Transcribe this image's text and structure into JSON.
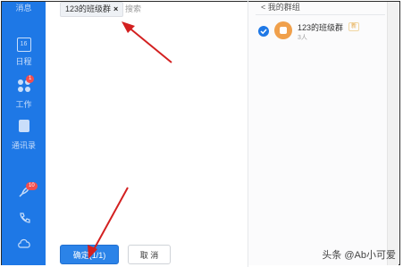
{
  "sidebar": {
    "items": [
      {
        "label": "消息",
        "icon": "chat-icon"
      },
      {
        "label": "日程",
        "icon": "calendar-icon",
        "icon_text": "16"
      },
      {
        "label": "工作",
        "icon": "apps-icon",
        "badge": "1"
      },
      {
        "label": "通讯录",
        "icon": "contacts-icon"
      },
      {
        "label": "",
        "icon": "rocket-icon",
        "badge": "10"
      },
      {
        "label": "",
        "icon": "phone-icon"
      },
      {
        "label": "",
        "icon": "cloud-icon"
      }
    ]
  },
  "selector": {
    "chip_label": "123的班级群",
    "chip_remove": "×",
    "search_placeholder": "搜索",
    "confirm_label": "确定(1/1)",
    "cancel_label": "取 消"
  },
  "right_panel": {
    "back_label": "< 我的群组",
    "groups": [
      {
        "name": "123的班级群",
        "tag": "新",
        "members": "3人",
        "selected": true
      }
    ]
  },
  "watermark": "头条 @Ab小可爱",
  "colors": {
    "accent": "#1e78e6",
    "arrow": "#d32020"
  }
}
